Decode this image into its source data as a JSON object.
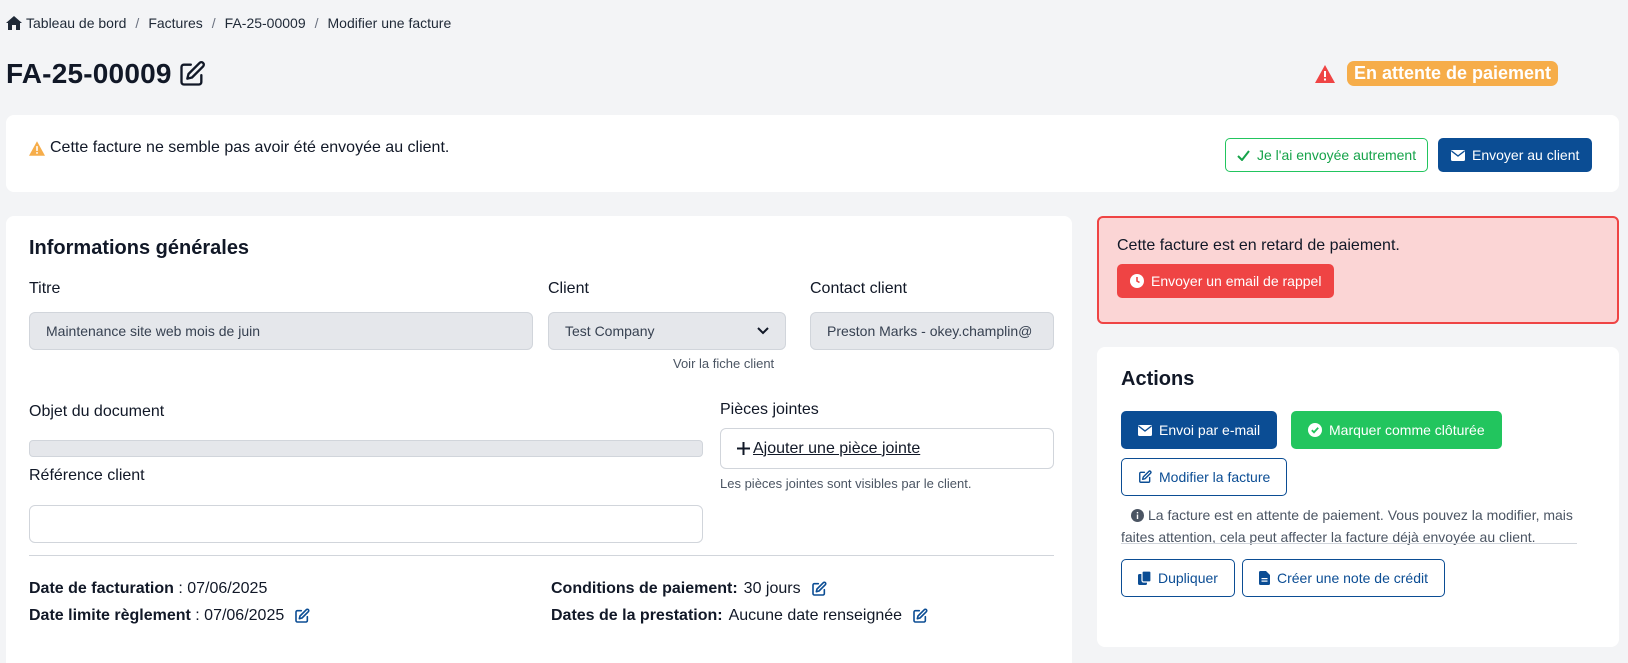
{
  "breadcrumb": {
    "home": "Tableau de bord",
    "invoices": "Factures",
    "invoice": "FA-25-00009",
    "current": "Modifier une facture"
  },
  "header": {
    "title": "FA-25-00009",
    "status": "En attente de paiement"
  },
  "notice": {
    "text": "Cette facture ne semble pas avoir été envoyée au client.",
    "sent_otherwise_label": "Je l'ai envoyée autrement",
    "send_client_label": "Envoyer au client"
  },
  "general": {
    "title": "Informations générales",
    "titre_label": "Titre",
    "titre_value": "Maintenance site web mois de juin",
    "client_label": "Client",
    "client_value": "Test Company",
    "client_link": "Voir la fiche client",
    "contact_label": "Contact client",
    "contact_value": "Preston Marks - okey.champlin@",
    "objet_label": "Objet du document",
    "reference_label": "Référence client",
    "reference_value": "",
    "attachments_label": "Pièces jointes",
    "add_attachment": "Ajouter une pièce jointe",
    "attachments_hint": "Les pièces jointes sont visibles par le client."
  },
  "details": {
    "date_facturation_label": "Date de facturation",
    "date_facturation_value": " : 07/06/2025",
    "date_limite_label": "Date limite règlement",
    "date_limite_value": " : 07/06/2025",
    "conditions_label": "Conditions de paiement:",
    "conditions_value": "30 jours",
    "prestation_label": "Dates de la prestation:",
    "prestation_value": "Aucune date renseignée"
  },
  "late_alert": {
    "text": "Cette facture est en retard de paiement.",
    "reminder_label": "Envoyer un email de rappel"
  },
  "actions": {
    "title": "Actions",
    "email_label": "Envoi par e-mail",
    "close_label": "Marquer comme clôturée",
    "edit_label": "Modifier la facture",
    "note": "La facture est en attente de paiement. Vous pouvez la modifier, mais faites attention, cela peut affecter la facture déjà envoyée au client.",
    "duplicate_label": "Dupliquer",
    "credit_note_label": "Créer une note de crédit"
  },
  "colors": {
    "primary": "#0b4d94",
    "success": "#22c55e",
    "danger": "#ef4444",
    "warning": "#f6ad4a"
  }
}
